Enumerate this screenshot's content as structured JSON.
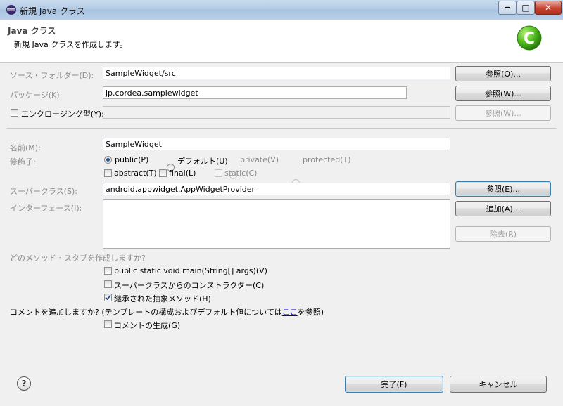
{
  "window": {
    "title": "新規 Java クラス",
    "minimize_glyph": "—",
    "maximize_glyph": "□",
    "close_glyph": "✕"
  },
  "header": {
    "title": "Java クラス",
    "subtitle": "新規 Java クラスを作成します。",
    "logo_glyph": "C"
  },
  "source_folder": {
    "label": "ソース・フォルダー(D):",
    "value": "SampleWidget/src",
    "browse": "参照(O)..."
  },
  "package": {
    "label": "パッケージ(K):",
    "value": "jp.cordea.samplewidget",
    "browse": "参照(W)..."
  },
  "enclosing_type": {
    "label": "エンクロージング型(Y):",
    "checked": false,
    "value": "",
    "browse": "参照(W)..."
  },
  "name": {
    "label": "名前(M):",
    "value": "SampleWidget"
  },
  "modifiers": {
    "label": "修飾子:",
    "radios": [
      {
        "label": "public(P)",
        "checked": true,
        "enabled": true
      },
      {
        "label": "デフォルト(U)",
        "checked": false,
        "enabled": true
      },
      {
        "label": "private(V)",
        "checked": false,
        "enabled": false
      },
      {
        "label": "protected(T)",
        "checked": false,
        "enabled": false
      }
    ],
    "checks": [
      {
        "label": "abstract(T)",
        "checked": false,
        "enabled": true
      },
      {
        "label": "final(L)",
        "checked": false,
        "enabled": true
      },
      {
        "label": "static(C)",
        "checked": false,
        "enabled": false
      }
    ]
  },
  "superclass": {
    "label": "スーパークラス(S):",
    "value": "android.appwidget.AppWidgetProvider",
    "browse": "参照(E)..."
  },
  "interfaces": {
    "label": "インターフェース(I):",
    "add": "追加(A)...",
    "remove": "除去(R)"
  },
  "stubs": {
    "question": "どのメソッド・スタブを作成しますか?",
    "options": [
      {
        "label": "public static void main(String[] args)(V)",
        "checked": false
      },
      {
        "label": "スーパークラスからのコンストラクター(C)",
        "checked": false
      },
      {
        "label": "継承された抽象メソッド(H)",
        "checked": true
      }
    ]
  },
  "comments": {
    "question_prefix": "コメントを追加しますか? (テンプレートの構成およびデフォルト値については",
    "link": "ここ",
    "question_suffix": "を参照)",
    "generate": {
      "label": "コメントの生成(G)",
      "checked": false
    }
  },
  "footer": {
    "help_glyph": "?",
    "finish": "完了(F)",
    "cancel": "キャンセル"
  }
}
